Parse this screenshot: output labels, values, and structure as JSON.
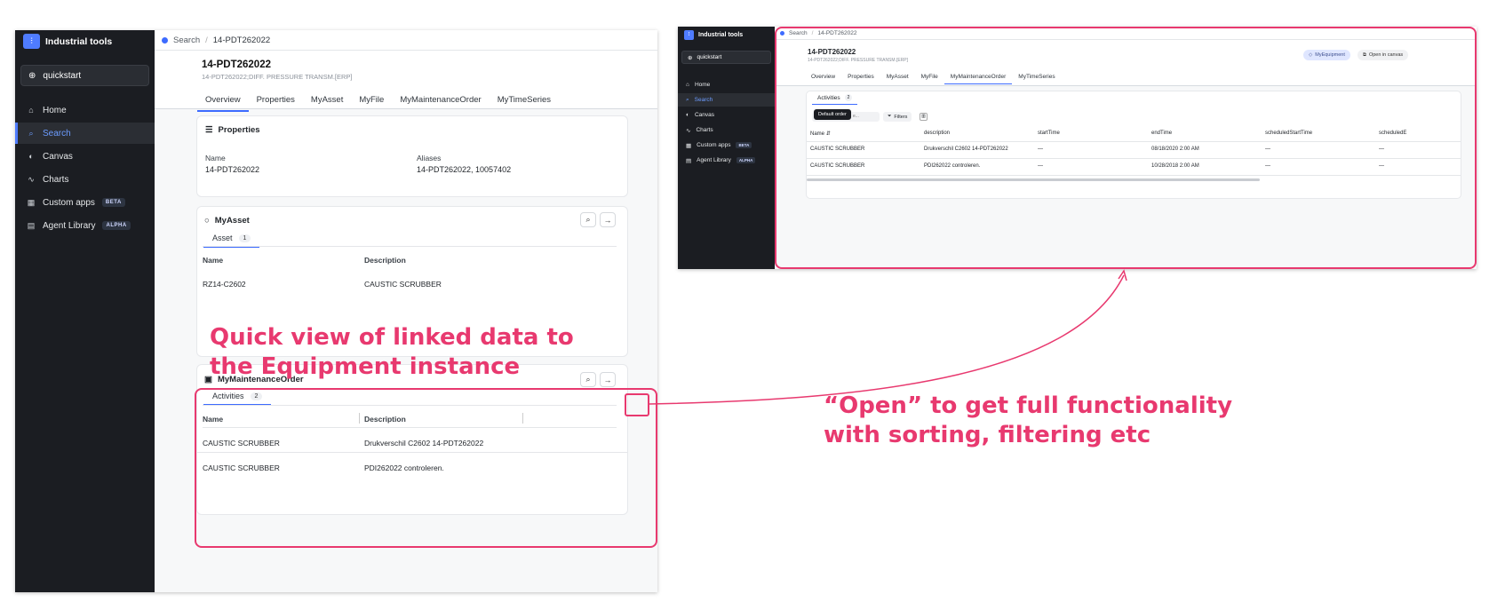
{
  "app": {
    "name": "Industrial tools",
    "project": "quickstart",
    "nav": [
      {
        "label": "Home",
        "icon": "home-icon"
      },
      {
        "label": "Search",
        "icon": "search-icon"
      },
      {
        "label": "Canvas",
        "icon": "canvas-icon"
      },
      {
        "label": "Charts",
        "icon": "charts-icon"
      },
      {
        "label": "Custom apps",
        "icon": "apps-icon",
        "tag": "BETA"
      },
      {
        "label": "Agent Library",
        "icon": "library-icon",
        "tag": "ALPHA"
      }
    ],
    "breadcrumb": {
      "root": "Search",
      "separator": "/",
      "current": "14-PDT262022"
    }
  },
  "equipment": {
    "title": "14-PDT262022",
    "subtitle": "14-PDT262022;DIFF. PRESSURE TRANSM.[ERP]",
    "tabs": [
      "Overview",
      "Properties",
      "MyAsset",
      "MyFile",
      "MyMaintenanceOrder",
      "MyTimeSeries"
    ]
  },
  "properties_card": {
    "title": "Properties",
    "name_label": "Name",
    "name_value": "14-PDT262022",
    "aliases_label": "Aliases",
    "aliases_value": "14-PDT262022, 10057402"
  },
  "asset_card": {
    "title": "MyAsset",
    "subtab": "Asset",
    "count": "1",
    "col_name": "Name",
    "col_description": "Description",
    "rows": [
      {
        "name": "RZ14-C2602",
        "description": "CAUSTIC SCRUBBER"
      }
    ]
  },
  "maintenance_card": {
    "title": "MyMaintenanceOrder",
    "subtab": "Activities",
    "count": "2",
    "col_name": "Name",
    "col_description": "Description",
    "rows": [
      {
        "name": "CAUSTIC SCRUBBER",
        "description": "Drukverschil C2602 14-PDT262022"
      },
      {
        "name": "CAUSTIC SCRUBBER",
        "description": "PDI262022 controleren."
      }
    ]
  },
  "annotations": {
    "quick_view": "Quick view of linked data to the Equipment instance",
    "open": "“Open” to get full functionality with sorting, filtering etc"
  },
  "detail_view": {
    "active_tab": "MyMaintenanceOrder",
    "badge_equipment": "MyEquipment",
    "open_in_canvas": "Open in canvas",
    "subtab": "Activities",
    "count": "2",
    "tooltip": "Default order",
    "search_suffix": "e...",
    "filters": "Filters",
    "columns": [
      "Name",
      "description",
      "startTime",
      "endTime",
      "scheduledStartTime",
      "scheduledE"
    ],
    "rows": [
      [
        "CAUSTIC SCRUBBER",
        "Drukverschil C2602 14-PDT262022",
        "—",
        "08/18/2020 2:00 AM",
        "—",
        "—"
      ],
      [
        "CAUSTIC SCRUBBER",
        "PDI262022 controleren.",
        "—",
        "10/28/2018 2:00 AM",
        "—",
        "—"
      ]
    ]
  },
  "colors": {
    "accent": "#3d6bff",
    "highlight": "#e8396f",
    "sidebar": "#1b1d22"
  }
}
